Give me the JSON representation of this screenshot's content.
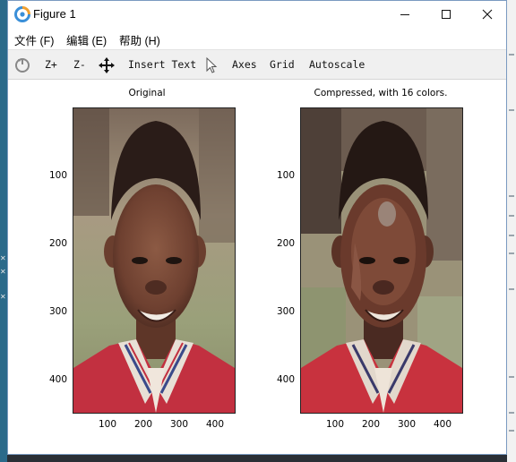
{
  "window": {
    "title": "Figure 1",
    "minimize_icon": "minimize-icon",
    "maximize_icon": "maximize-icon",
    "close_icon": "close-icon"
  },
  "menu": [
    {
      "label": "文件 (F)"
    },
    {
      "label": "编辑 (E)"
    },
    {
      "label": "帮助 (H)"
    }
  ],
  "toolbar": {
    "reset_icon": "reset-view-icon",
    "zoom_in": "Z+",
    "zoom_out": "Z-",
    "pan_icon": "pan-move-icon",
    "insert_text": "Insert Text",
    "select_icon": "pointer-icon",
    "axes": "Axes",
    "grid": "Grid",
    "autoscale": "Autoscale"
  },
  "plots": [
    {
      "title": "Original",
      "image": "photo-original",
      "x_ticks": [
        "100",
        "200",
        "300",
        "400"
      ],
      "y_ticks": [
        "100",
        "200",
        "300",
        "400"
      ]
    },
    {
      "title": "Compressed, with 16 colors.",
      "image": "photo-compressed-16-colors",
      "x_ticks": [
        "100",
        "200",
        "300",
        "400"
      ],
      "y_ticks": [
        "100",
        "200",
        "300",
        "400"
      ]
    }
  ],
  "colors": {
    "window_border": "#7a9ac0",
    "toolbar_bg": "#f0f0f0",
    "shirt_red": "#c23040",
    "skin": "#7a4a38",
    "hair": "#2a1c18"
  }
}
